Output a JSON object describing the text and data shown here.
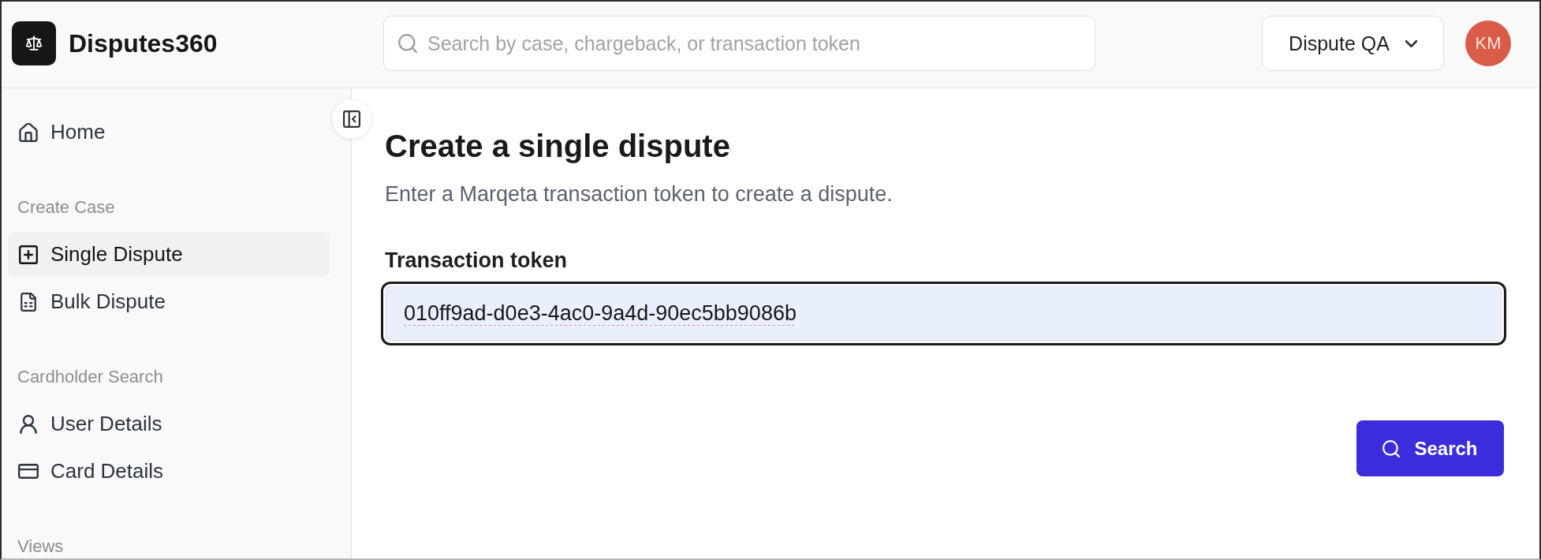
{
  "header": {
    "app_name": "Disputes360",
    "search": {
      "placeholder": "Search by case, chargeback, or transaction token"
    },
    "workspace": {
      "label": "Dispute QA"
    },
    "avatar": {
      "initials": "KM"
    }
  },
  "sidebar": {
    "sections": [
      {
        "items": [
          {
            "label": "Home",
            "selected": false
          }
        ]
      },
      {
        "title": "Create Case",
        "items": [
          {
            "label": "Single Dispute",
            "selected": true
          },
          {
            "label": "Bulk Dispute",
            "selected": false
          }
        ]
      },
      {
        "title": "Cardholder Search",
        "items": [
          {
            "label": "User Details",
            "selected": false
          },
          {
            "label": "Card Details",
            "selected": false
          }
        ]
      },
      {
        "title": "Views"
      }
    ]
  },
  "main": {
    "title": "Create a single dispute",
    "description": "Enter a Marqeta transaction token to create a dispute.",
    "field": {
      "label": "Transaction token",
      "value": "010ff9ad-d0e3-4ac0-9a4d-90ec5bb9086b",
      "focused": true
    },
    "submit_button": {
      "label": "Search"
    }
  }
}
